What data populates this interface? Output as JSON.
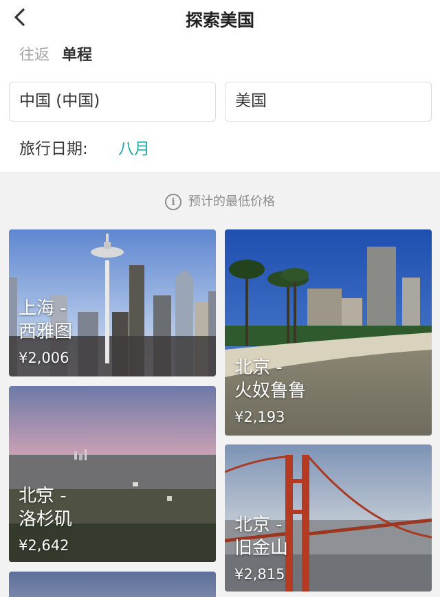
{
  "header": {
    "title": "探索美国"
  },
  "trip_type": {
    "round_trip": "往返",
    "one_way": "单程",
    "selected": "one_way"
  },
  "search": {
    "origin": "中国 (中国)",
    "destination": "美国"
  },
  "date": {
    "label": "旅行日期:",
    "value": "八月"
  },
  "note": {
    "text": "预计的最低价格"
  },
  "colors": {
    "accent": "#1fa6a6",
    "inactive": "#a8a8a8",
    "background_gray": "#f2f2f2"
  },
  "icons": {
    "back": "chevron-left-icon",
    "info": "info-circle-icon"
  },
  "destinations": [
    {
      "origin": "上海 -",
      "city": "西雅图",
      "price": "¥2,006"
    },
    {
      "origin": "北京 -",
      "city": "火奴鲁鲁",
      "price": "¥2,193"
    },
    {
      "origin": "北京 -",
      "city": "洛杉矶",
      "price": "¥2,642"
    },
    {
      "origin": "北京 -",
      "city": "旧金山",
      "price": "¥2,815"
    }
  ]
}
